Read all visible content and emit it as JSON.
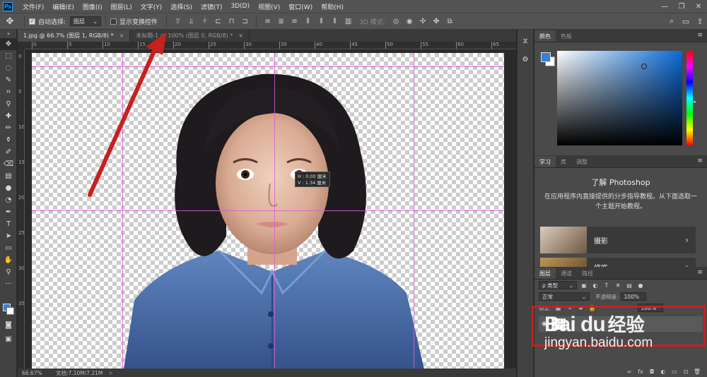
{
  "app": {
    "logo": "Ps"
  },
  "menu": [
    "文件(F)",
    "编辑(E)",
    "图像(I)",
    "图层(L)",
    "文字(Y)",
    "选择(S)",
    "滤镜(T)",
    "3D(D)",
    "视图(V)",
    "窗口(W)",
    "帮助(H)"
  ],
  "window_controls": [
    "—",
    "❐",
    "✕"
  ],
  "options": {
    "auto_select_label": "自动选择:",
    "auto_select_value": "图层",
    "show_transform_label": "显示变换控件",
    "mode_3d_label": "3D 模式:"
  },
  "tabs": [
    {
      "label": "1.jpg @ 66.7% (图层 1, RGB/8) *",
      "close": "×"
    },
    {
      "label": "未标题-1 @ 100% (图层 0, RGB/8) *",
      "close": "×"
    }
  ],
  "ruler_top": [
    "0",
    "5",
    "10",
    "15",
    "20",
    "25",
    "30",
    "35",
    "40",
    "45",
    "50",
    "55",
    "60",
    "65"
  ],
  "ruler_left": [
    "0",
    "5",
    "10",
    "15",
    "20",
    "25",
    "30",
    "35"
  ],
  "measure_tip": {
    "h": "H : 0.00 厘米",
    "v": "V : 1.34 厘米"
  },
  "status": {
    "zoom": "66.67%",
    "doc": "文档:7.10M/7.21M",
    "arrow": ">"
  },
  "color_panel": {
    "tabs": [
      "颜色",
      "色板"
    ]
  },
  "learn_panel": {
    "tabs": [
      "学习",
      "库",
      "调整"
    ],
    "title": "了解 Photoshop",
    "desc": "在应用程序内直接提供的分步指导教程。从下面选取一个主题开始教程。",
    "cards": [
      {
        "label": "摄影"
      },
      {
        "label": "修饰"
      }
    ]
  },
  "layers_panel": {
    "tabs": [
      "图层",
      "通道",
      "路径"
    ],
    "kind_filter": "ρ 类型",
    "blend_mode": "正常",
    "opacity_label": "不透明度:",
    "opacity_value": "100%",
    "lock_label": "锁定:",
    "fill_value": "100%",
    "bottom_icons": [
      "∞",
      "fx",
      "◘",
      "◐",
      "▭",
      "⊡",
      "🗑"
    ]
  },
  "watermark": {
    "logo": "Bai du",
    "jingyan": "经验",
    "url": "jingyan.baidu.com"
  },
  "colors": {
    "foreground": "#3b7fd4",
    "guide": "#e05ad8",
    "annotation": "#c8201e"
  }
}
